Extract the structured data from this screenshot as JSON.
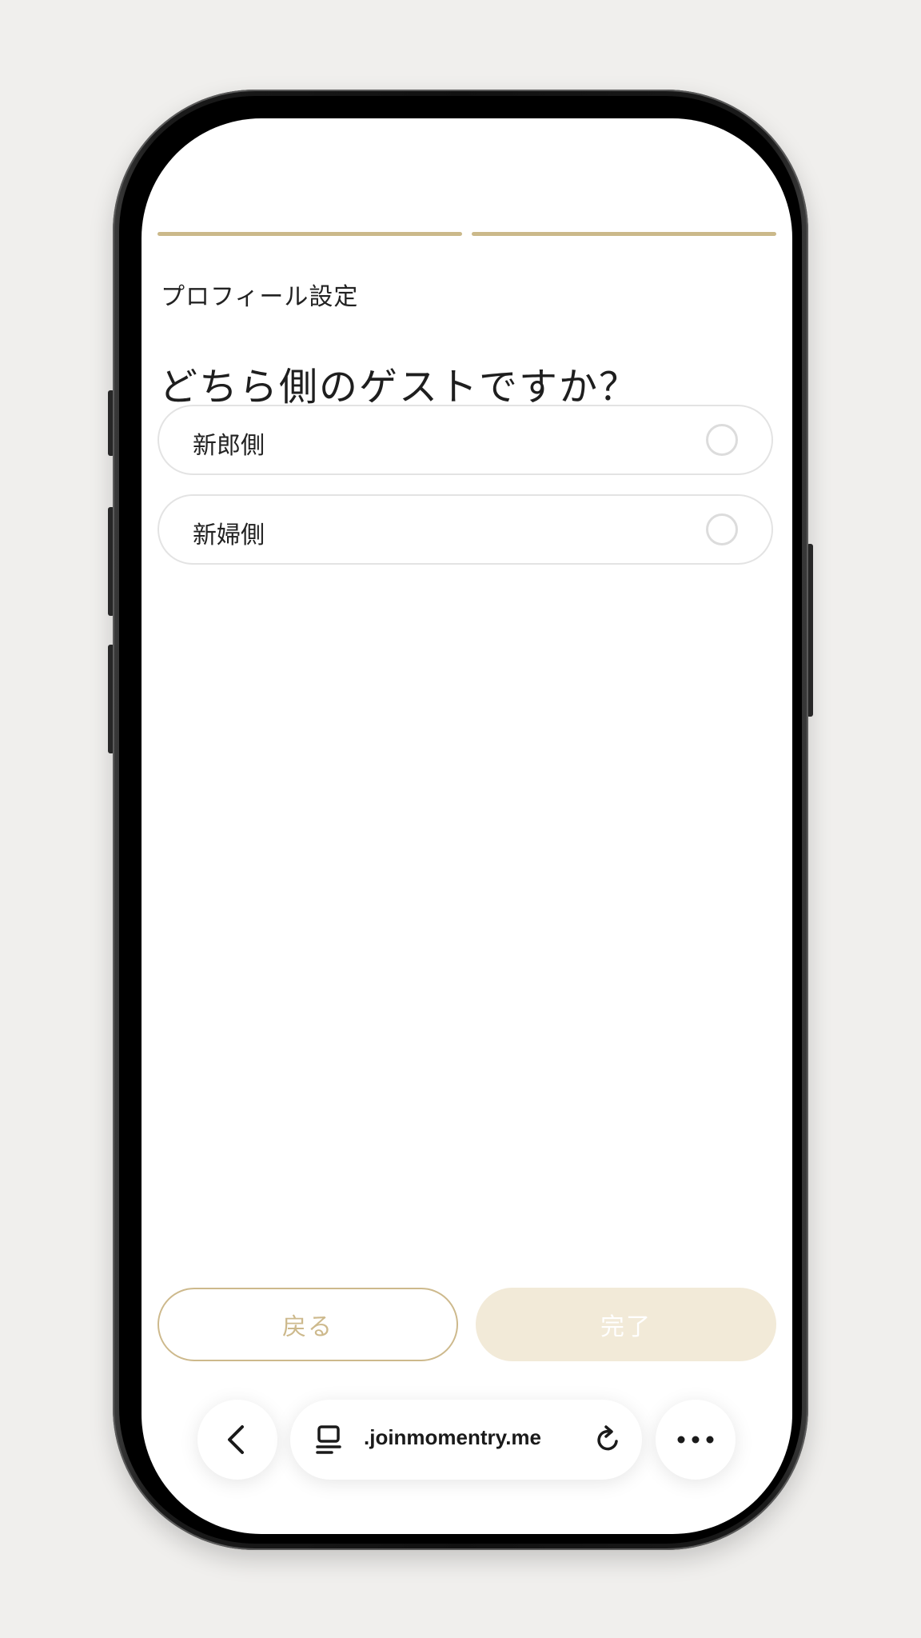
{
  "progress": {
    "segments": 2,
    "completed": 2,
    "color": "#cbb98a"
  },
  "header": {
    "section_label": "プロフィール設定"
  },
  "question": {
    "title": "どちら側のゲストですか？"
  },
  "options": [
    {
      "label": "新郎側",
      "selected": false
    },
    {
      "label": "新婦側",
      "selected": false
    }
  ],
  "actions": {
    "back_label": "戻る",
    "done_label": "完了",
    "accent_color": "#cdb98c",
    "done_disabled": true
  },
  "browser": {
    "url": ".joinmomentry.me",
    "back_icon": "chevron-left-icon",
    "tabs_icon": "page-menu-icon",
    "reload_icon": "reload-icon",
    "more_icon": "more-dots-icon"
  }
}
